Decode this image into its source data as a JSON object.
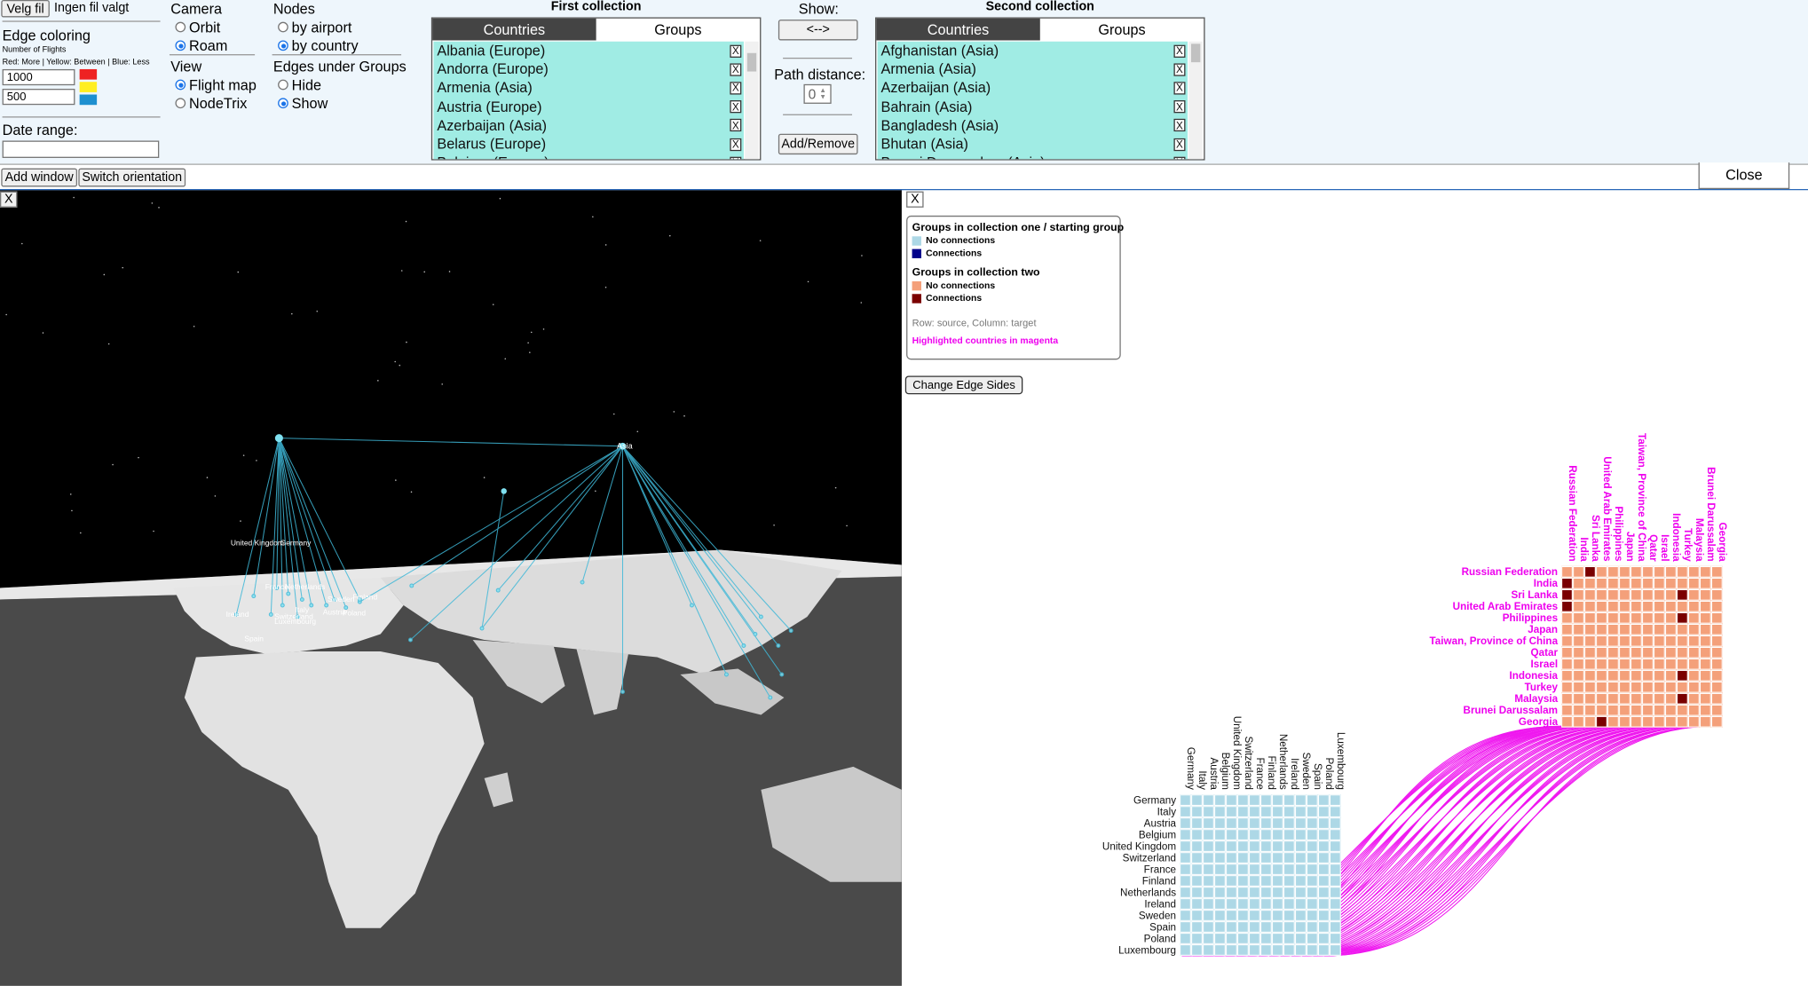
{
  "toolbar": {
    "file_button": "Velg fil",
    "file_status": "Ingen fil valgt",
    "edge_coloring_title": "Edge coloring",
    "edge_coloring_sub": "Number of Flights",
    "edge_coloring_legend": "Red: More | Yellow: Between | Blue: Less",
    "threshold_high": "1000",
    "threshold_low": "500",
    "color_high": "#ee2222",
    "color_mid": "#ffee22",
    "color_low": "#1e90d0",
    "date_range_label": "Date range:",
    "date_range_value": "",
    "camera_label": "Camera",
    "camera_orbit": "Orbit",
    "camera_roam": "Roam",
    "view_label": "View",
    "view_flight_map": "Flight map",
    "view_nodetrix": "NodeTrix",
    "nodes_label": "Nodes",
    "nodes_by_airport": "by airport",
    "nodes_by_country": "by country",
    "edges_label": "Edges under Groups",
    "edges_hide": "Hide",
    "edges_show": "Show",
    "show_label": "Show:",
    "swap_button": "<-->",
    "path_distance_label": "Path distance:",
    "path_distance_value": "0",
    "add_remove_button": "Add/Remove",
    "add_window_button": "Add window",
    "switch_orientation_button": "Switch orientation",
    "close_button": "Close"
  },
  "first_collection": {
    "title": "First collection",
    "tab_countries": "Countries",
    "tab_groups": "Groups",
    "items": [
      "Albania (Europe)",
      "Andorra (Europe)",
      "Armenia (Asia)",
      "Austria (Europe)",
      "Azerbaijan (Asia)",
      "Belarus (Europe)",
      "Belgium (Europe)"
    ]
  },
  "second_collection": {
    "title": "Second collection",
    "tab_countries": "Countries",
    "tab_groups": "Groups",
    "items": [
      "Afghanistan (Asia)",
      "Armenia (Asia)",
      "Azerbaijan (Asia)",
      "Bahrain (Asia)",
      "Bangladesh (Asia)",
      "Bhutan (Asia)",
      "Brunei Darussalam (Asia)"
    ]
  },
  "left_window": {
    "close_label": "X",
    "europe_labels": [
      "United Kingdom",
      "Germany",
      "France",
      "Netherlands",
      "Sweden",
      "Finland",
      "Ireland",
      "Italy",
      "Switzerland",
      "Luxembourg",
      "Austria",
      "Poland",
      "Spain"
    ],
    "asia_label": "Asia"
  },
  "right_window": {
    "close_label": "X",
    "legend": {
      "group1_title": "Groups in collection one / starting group",
      "group1_none": "No connections",
      "group1_conn": "Connections",
      "group2_title": "Groups in collection two",
      "group2_none": "No connections",
      "group2_conn": "Connections",
      "note": "Row: source, Column: target",
      "highlight": "Highlighted countries in magenta",
      "color_g1_none": "#add8e6",
      "color_g1_conn": "#00008b",
      "color_g2_none": "#f4a07a",
      "color_g2_conn": "#7a0000",
      "color_highlight": "#ee00ee"
    },
    "change_edge_sides_button": "Change Edge Sides",
    "asia_matrix": {
      "labels": [
        "Russian Federation",
        "India",
        "Sri Lanka",
        "United Arab Emirates",
        "Philippines",
        "Japan",
        "Taiwan, Province of China",
        "Qatar",
        "Israel",
        "Indonesia",
        "Turkey",
        "Malaysia",
        "Brunei Darussalam",
        "Georgia"
      ],
      "connections": [
        [
          0,
          2
        ],
        [
          1,
          0
        ],
        [
          2,
          0
        ],
        [
          2,
          10
        ],
        [
          3,
          0
        ],
        [
          4,
          10
        ],
        [
          9,
          10
        ],
        [
          11,
          10
        ],
        [
          13,
          3
        ]
      ]
    },
    "europe_matrix": {
      "labels": [
        "Germany",
        "Italy",
        "Austria",
        "Belgium",
        "United Kingdom",
        "Switzerland",
        "France",
        "Finland",
        "Netherlands",
        "Ireland",
        "Sweden",
        "Spain",
        "Poland",
        "Luxembourg"
      ],
      "connections": []
    }
  }
}
